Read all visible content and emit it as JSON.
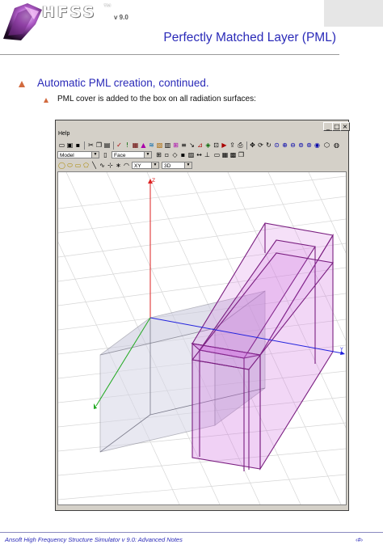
{
  "logo": {
    "name": "HFSS",
    "tm": "™",
    "version": "v 9.0"
  },
  "title": "Perfectly Matched Layer (PML)",
  "bullets": {
    "level1": "Automatic PML creation, continued.",
    "level2": "PML cover is added to the box on all radiation surfaces:"
  },
  "window": {
    "menu": "Help",
    "controls": [
      "_",
      "□",
      "×"
    ],
    "combo_model": "Model",
    "combo_face": "Face",
    "combo_plane": "XY",
    "combo_view": "3D",
    "axis_labels": {
      "z": "Z",
      "y": "Y"
    }
  },
  "colors": {
    "title_blue": "#2a2ab8",
    "bullet_orange": "#d26a3e",
    "pml_magenta": "#b030c0"
  },
  "footer": {
    "left": "Ansoft High Frequency Structure Simulator v 9.0: Advanced Notes",
    "right": "‹#›"
  }
}
